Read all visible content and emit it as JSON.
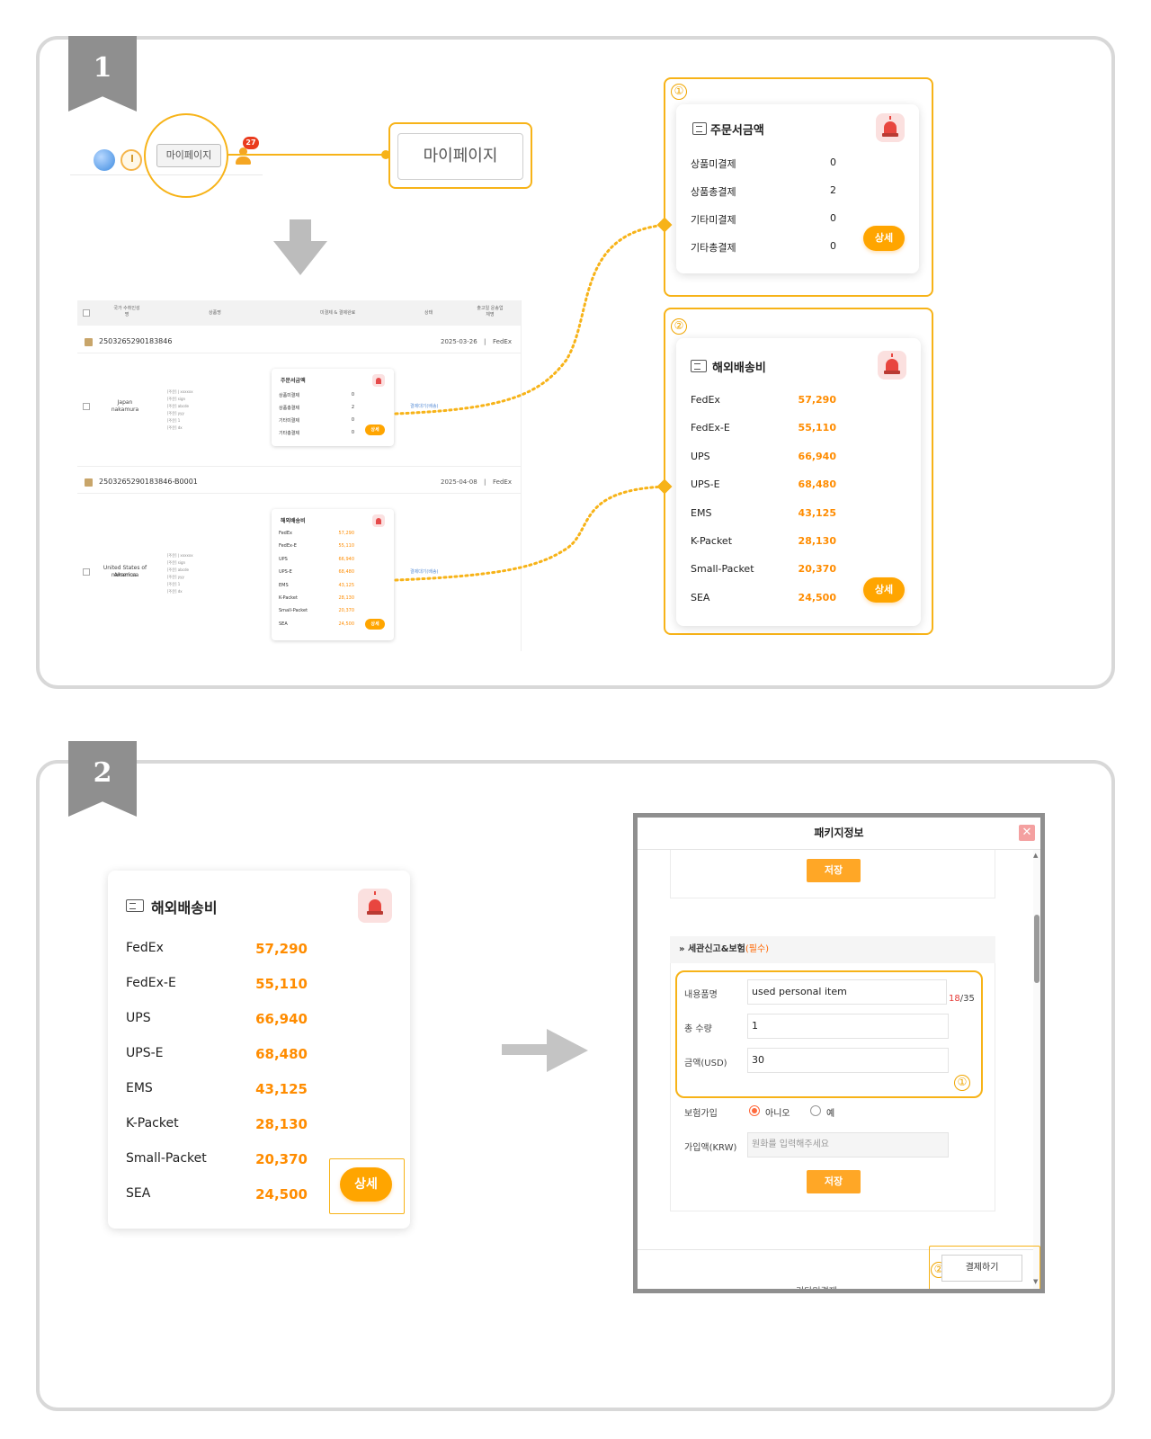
{
  "steps": {
    "one": "1",
    "two": "2"
  },
  "topbar": {
    "notification_count": "27",
    "mypage_label": "마이페이지",
    "mypage_zoom_label": "마이페이지"
  },
  "callouts": {
    "c1": "①",
    "c2": "②"
  },
  "mini_table": {
    "headers": [
      "국가\n수취인성명",
      "상품명",
      "미결제 & 결제완료",
      "상태",
      "출고일\n운송업체명"
    ],
    "orders": [
      {
        "order_no": "2503265290183846",
        "date": "2025-03-26",
        "sep": "|",
        "carrier": "FedEx",
        "country": "Japan",
        "name": "nakamura",
        "lines": [
          "[주문] | xxxxxx",
          "[주문] sign",
          "[주문] abcde",
          "[주문] yyy",
          "[주문] 1",
          "[주문] dx"
        ],
        "link": "결제대기(배송)"
      },
      {
        "order_no": "2503265290183846-B0001",
        "date": "2025-04-08",
        "sep": "|",
        "carrier": "FedEx",
        "country": "United States of America",
        "name": "nakamura",
        "lines": [
          "[주문] | xxxxxx",
          "[주문] sign",
          "[주문] abcde",
          "[주문] yyy",
          "[주문] 1",
          "[주문] dx"
        ],
        "link": "결제대기(배송)"
      }
    ]
  },
  "order_amount_card": {
    "title": "주문서금액",
    "rows": [
      {
        "label": "상품미결제",
        "value": "0"
      },
      {
        "label": "상품총결제",
        "value": "2"
      },
      {
        "label": "기타미결제",
        "value": "0"
      },
      {
        "label": "기타총결제",
        "value": "0"
      }
    ],
    "detail_button": "상세"
  },
  "shipping_card": {
    "title": "해외배송비",
    "rows": [
      {
        "label": "FedEx",
        "value": "57,290"
      },
      {
        "label": "FedEx-E",
        "value": "55,110"
      },
      {
        "label": "UPS",
        "value": "66,940"
      },
      {
        "label": "UPS-E",
        "value": "68,480"
      },
      {
        "label": "EMS",
        "value": "43,125"
      },
      {
        "label": "K-Packet",
        "value": "28,130"
      },
      {
        "label": "Small-Packet",
        "value": "20,370"
      },
      {
        "label": "SEA",
        "value": "24,500"
      }
    ],
    "detail_button": "상세"
  },
  "package_modal": {
    "title": "패키지정보",
    "close": "✕",
    "save_top": "저장",
    "section_title": "» 세관신고&보험",
    "section_required": "(필수)",
    "fields": {
      "content_label": "내용품명",
      "content_value": "used personal item",
      "counter_cur": "18",
      "counter_max": "/35",
      "qty_label": "총 수량",
      "qty_value": "1",
      "amount_label": "금액(USD)",
      "amount_value": "30"
    },
    "insurance_label": "보험가입",
    "insurance_no": "아니오",
    "insurance_yes": "예",
    "insured_amount_label": "가입액(KRW)",
    "insured_amount_placeholder": "원화를 입력해주세요",
    "save_bottom": "저장",
    "pay_button": "결제하기",
    "bg_text": "기타미결제"
  },
  "colors": {
    "accent": "#ffa500",
    "highlight": "#f7b318",
    "value_orange": "#ff8c00"
  }
}
